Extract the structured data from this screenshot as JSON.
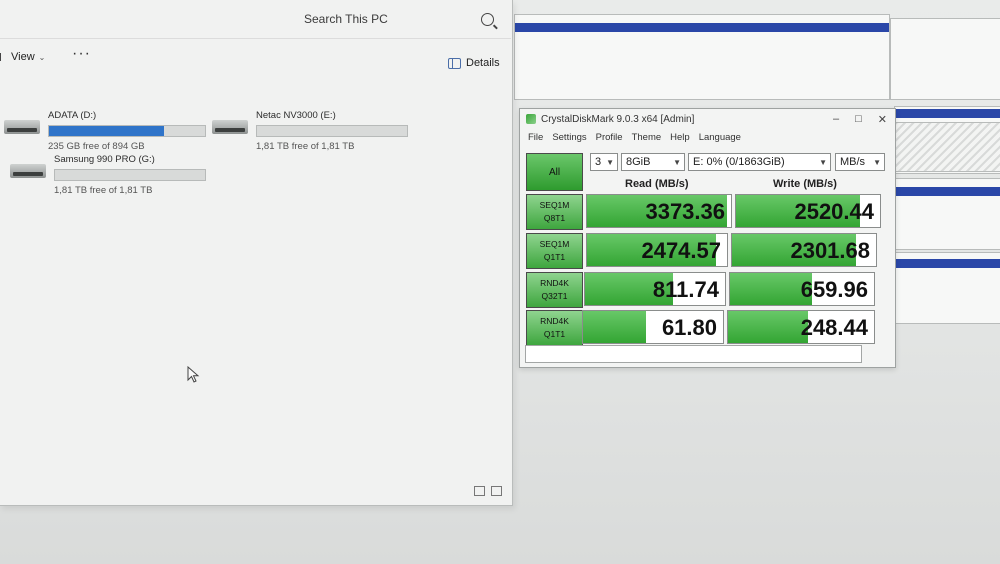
{
  "explorer": {
    "search_placeholder": "Search This PC",
    "toolbar": {
      "view_label": "View",
      "more_label": "···",
      "details_label": "Details"
    },
    "drives": [
      {
        "name": "ADATA (D:)",
        "free_text": "235 GB free of 894 GB",
        "used_fraction": 0.74
      },
      {
        "name": "Netac NV3000 (E:)",
        "free_text": "1,81 TB free of 1,81 TB",
        "used_fraction": 0.0
      },
      {
        "name": "Samsung 990 PRO (G:)",
        "free_text": "1,81 TB free of 1,81 TB",
        "used_fraction": 0.0
      }
    ]
  },
  "cdm": {
    "title": "CrystalDiskMark 9.0.3 x64 [Admin]",
    "window_controls": [
      "–",
      "□",
      "✕"
    ],
    "menu": [
      "File",
      "Settings",
      "Profile",
      "Theme",
      "Help",
      "Language"
    ],
    "all_button": "All",
    "count": "3",
    "size": "8GiB",
    "drive": "E: 0% (0/1863GiB)",
    "unit": "MB/s",
    "read_header": "Read (MB/s)",
    "write_header": "Write (MB/s)",
    "rows": [
      {
        "line1": "SEQ1M",
        "line2": "Q8T1",
        "read": "3373.36",
        "write": "2520.44",
        "read_fill": 0.97,
        "write_fill": 0.86
      },
      {
        "line1": "SEQ1M",
        "line2": "Q1T1",
        "read": "2474.57",
        "write": "2301.68",
        "read_fill": 0.92,
        "write_fill": 0.86
      },
      {
        "line1": "RND4K",
        "line2": "Q32T1",
        "read": "811.74",
        "write": "659.96",
        "read_fill": 0.63,
        "write_fill": 0.57
      },
      {
        "line1": "RND4K",
        "line2": "Q1T1",
        "read": "61.80",
        "write": "248.44",
        "read_fill": 0.45,
        "write_fill": 0.55
      }
    ]
  },
  "colors": {
    "green": "#33a533",
    "drive_bar": "#2f74c9",
    "title_bar_blue": "#2a47a8"
  }
}
